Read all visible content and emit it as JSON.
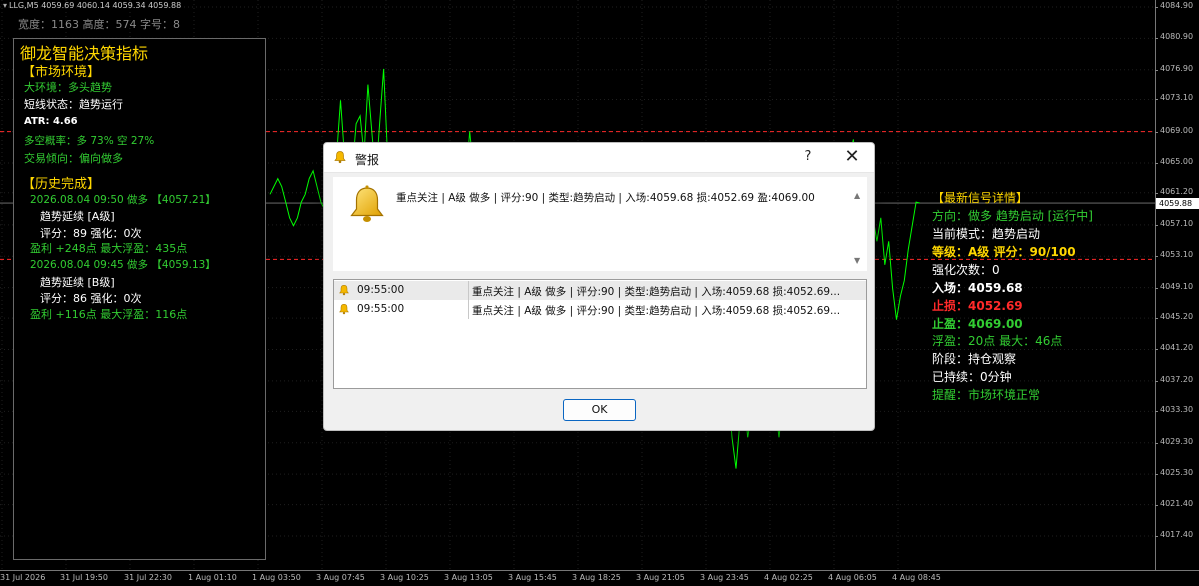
{
  "chart": {
    "symbol_line": "LLG,M5   4059.69 4060.14 4059.34 4059.88",
    "dimensions_line": "宽度：1163  高度：574  字号：8",
    "current_price": "4059.88",
    "price_ticks": [
      "4084.90",
      "4080.90",
      "4076.90",
      "4073.10",
      "4069.00",
      "4065.00",
      "4061.20",
      "4057.10",
      "4053.10",
      "4049.10",
      "4045.20",
      "4041.20",
      "4037.20",
      "4033.30",
      "4029.30",
      "4025.30",
      "4021.40",
      "4017.40"
    ],
    "time_ticks": [
      "31 Jul 2026",
      "31 Jul 19:50",
      "31 Jul 22:30",
      "1 Aug 01:10",
      "1 Aug 03:50",
      "3 Aug 07:45",
      "3 Aug 10:25",
      "3 Aug 13:05",
      "3 Aug 15:45",
      "3 Aug 18:25",
      "3 Aug 21:05",
      "3 Aug 23:45",
      "4 Aug 02:25",
      "4 Aug 06:05",
      "4 Aug 08:45"
    ],
    "colors": {
      "background": "#000000",
      "line": "#00ff00",
      "level_line": "#ff2a2a",
      "grid": "#1f1f1f"
    },
    "price_path": [
      4061,
      4062,
      4063,
      4062,
      4060,
      4058,
      4057,
      4058,
      4060,
      4061,
      4063,
      4064,
      4062,
      4060,
      4059,
      4061,
      4063,
      4066,
      4073,
      4066,
      4060,
      4064,
      4070,
      4071,
      4066,
      4075,
      4069,
      4063,
      4070,
      4077,
      4066,
      4060,
      4064,
      4066,
      4063,
      4060,
      4059,
      4062,
      4058,
      4056,
      4059,
      4061,
      4058,
      4055,
      4056,
      4060,
      4062,
      4059,
      4058,
      4060,
      4063,
      4069,
      4064,
      4059,
      4057,
      4059,
      4057,
      4056,
      4058,
      4060,
      4059,
      4058,
      4060,
      4058,
      4057,
      4059,
      4061,
      4058,
      4057,
      4056,
      4058,
      4059,
      4057,
      4056,
      4058,
      4059,
      4057,
      4056,
      4058,
      4057,
      4058,
      4059,
      4057,
      4058,
      4056,
      4055,
      4057,
      4056,
      4058,
      4057,
      4059,
      4058,
      4057,
      4056,
      4058,
      4059,
      4057,
      4058,
      4056,
      4057,
      4059,
      4058,
      4057,
      4056,
      4058,
      4059,
      4057,
      4058,
      4059,
      4058,
      4057,
      4056,
      4058,
      4059,
      4057,
      4058,
      4056,
      4036,
      4030,
      4026,
      4032,
      4035,
      4030,
      4033,
      4036,
      4034,
      4032,
      4035,
      4033,
      4034,
      4030,
      4035,
      4033,
      4036,
      4040,
      4034,
      4037,
      4039,
      4034,
      4040,
      4058,
      4062,
      4066,
      4063,
      4060,
      4062,
      4064,
      4061,
      4066,
      4068,
      4062,
      4064,
      4066,
      4063,
      4058,
      4055,
      4058,
      4052,
      4055,
      4049,
      4045,
      4048,
      4050,
      4054,
      4057,
      4060,
      4059.88
    ]
  },
  "left_panel": {
    "title": "御龙智能决策指标",
    "market_env_header": "【市场环境】",
    "big_env": "大环境：多头趋势",
    "short_state": "短线状态：趋势运行",
    "atr": "ATR: 4.66",
    "prob": "多空概率：多 73%  空 27%",
    "tendency": "交易倾向：偏向做多",
    "history_header": "【历史完成】",
    "history": [
      {
        "line1": "2026.08.04 09:50 做多 【4057.21】",
        "line2": "趋势延续 [A级]",
        "line3": "评分：89  强化：0次",
        "line4": "盈利 +248点  最大浮盈：435点"
      },
      {
        "line1": "2026.08.04 09:45 做多 【4059.13】",
        "line2": "趋势延续 [B级]",
        "line3": "评分：86  强化：0次",
        "line4": "盈利 +116点  最大浮盈：116点"
      }
    ]
  },
  "right_panel": {
    "header": "【最新信号详情】",
    "direction": "方向：做多 趋势启动 [运行中]",
    "mode": "当前模式：趋势启动",
    "grade": "等级：A级  评分：90/100",
    "reinforce": "强化次数：0",
    "entry": "入场：4059.68",
    "stop": "止损：4052.69",
    "target": "止盈：4069.00",
    "float": "浮盈：20点  最大：46点",
    "stage": "阶段：持仓观察",
    "held": "已持续：0分钟",
    "reminder": "提醒：市场环境正常"
  },
  "dialog": {
    "title": "警报",
    "help": "?",
    "close": "✕",
    "message": "重点关注 | A级 做多 | 评分:90 | 类型:趋势启动 | 入场:4059.68 损:4052.69 盈:4069.00",
    "rows": [
      {
        "time": "09:55:00",
        "text": "重点关注 | A级 做多 | 评分:90 | 类型:趋势启动 | 入场:4059.68 损:4052.69..."
      },
      {
        "time": "09:55:00",
        "text": "重点关注 | A级 做多 | 评分:90 | 类型:趋势启动 | 入场:4059.68 损:4052.69..."
      }
    ],
    "ok_label": "OK"
  }
}
